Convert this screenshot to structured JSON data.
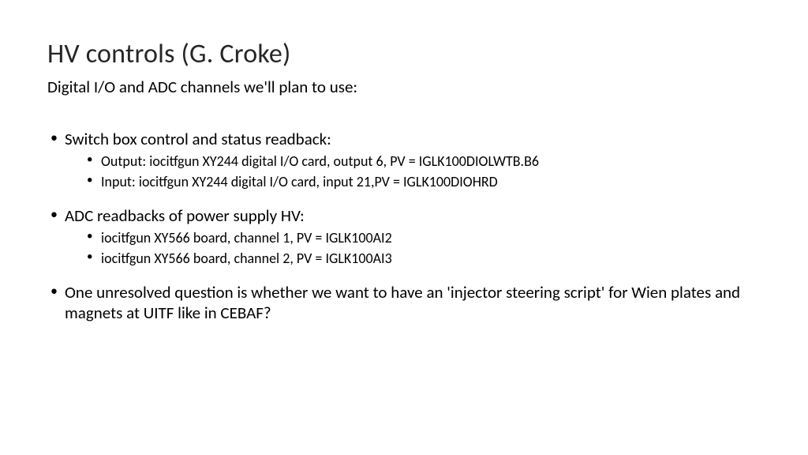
{
  "title": "HV controls (G. Croke)",
  "subtitle": "Digital I/O and ADC channels we'll plan to use:",
  "bullets": [
    {
      "text": "Switch box control and status readback:",
      "sub": [
        "Output:  iocitfgun XY244 digital I/O card, output 6, PV = IGLK100DIOLWTB.B6",
        "Input:   iocitfgun XY244 digital I/O card, input 21,PV = IGLK100DIOHRD"
      ]
    },
    {
      "text": "ADC readbacks of power supply HV:",
      "sub": [
        "iocitfgun XY566 board, channel 1, PV = IGLK100AI2",
        "iocitfgun XY566 board, channel 2, PV = IGLK100AI3"
      ]
    },
    {
      "text": "One unresolved question is whether we want to have an 'injector steering script' for Wien plates and magnets at UITF like in CEBAF?",
      "sub": []
    }
  ]
}
